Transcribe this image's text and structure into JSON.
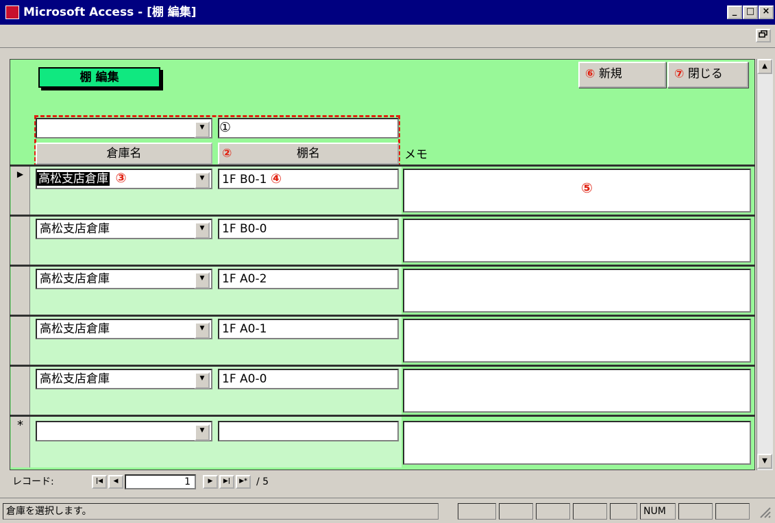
{
  "window": {
    "title": "Microsoft Access - [棚 編集]",
    "minimize": "_",
    "maximize": "□",
    "close": "×",
    "restore": "ð"
  },
  "form": {
    "title": "棚 編集",
    "new_button": {
      "mark": "⑥",
      "label": "新規"
    },
    "close_button": {
      "mark": "⑦",
      "label": "閉じる"
    },
    "header": {
      "mark_filter": "①",
      "mark_headers": "②",
      "col_warehouse": "倉庫名",
      "col_shelf": "棚名",
      "col_memo": "メモ"
    },
    "annotations": {
      "warehouse_field": "③",
      "shelf_field": "④",
      "memo_field": "⑤"
    },
    "rows": [
      {
        "selector": "▶",
        "warehouse": "高松支店倉庫",
        "shelf": "1F B0-1",
        "memo": ""
      },
      {
        "selector": "",
        "warehouse": "高松支店倉庫",
        "shelf": "1F B0-0",
        "memo": ""
      },
      {
        "selector": "",
        "warehouse": "高松支店倉庫",
        "shelf": "1F A0-2",
        "memo": ""
      },
      {
        "selector": "",
        "warehouse": "高松支店倉庫",
        "shelf": "1F A0-1",
        "memo": ""
      },
      {
        "selector": "",
        "warehouse": "高松支店倉庫",
        "shelf": "1F A0-0",
        "memo": ""
      },
      {
        "selector": "*",
        "warehouse": "",
        "shelf": "",
        "memo": ""
      }
    ]
  },
  "record_nav": {
    "label": "レコード:",
    "current": "1",
    "total": "/ 5",
    "first": "|◀",
    "prev": "◀",
    "next": "▶",
    "last": "▶|",
    "new": "▶*"
  },
  "status": {
    "message": "倉庫を選択します。",
    "num": "NUM"
  }
}
